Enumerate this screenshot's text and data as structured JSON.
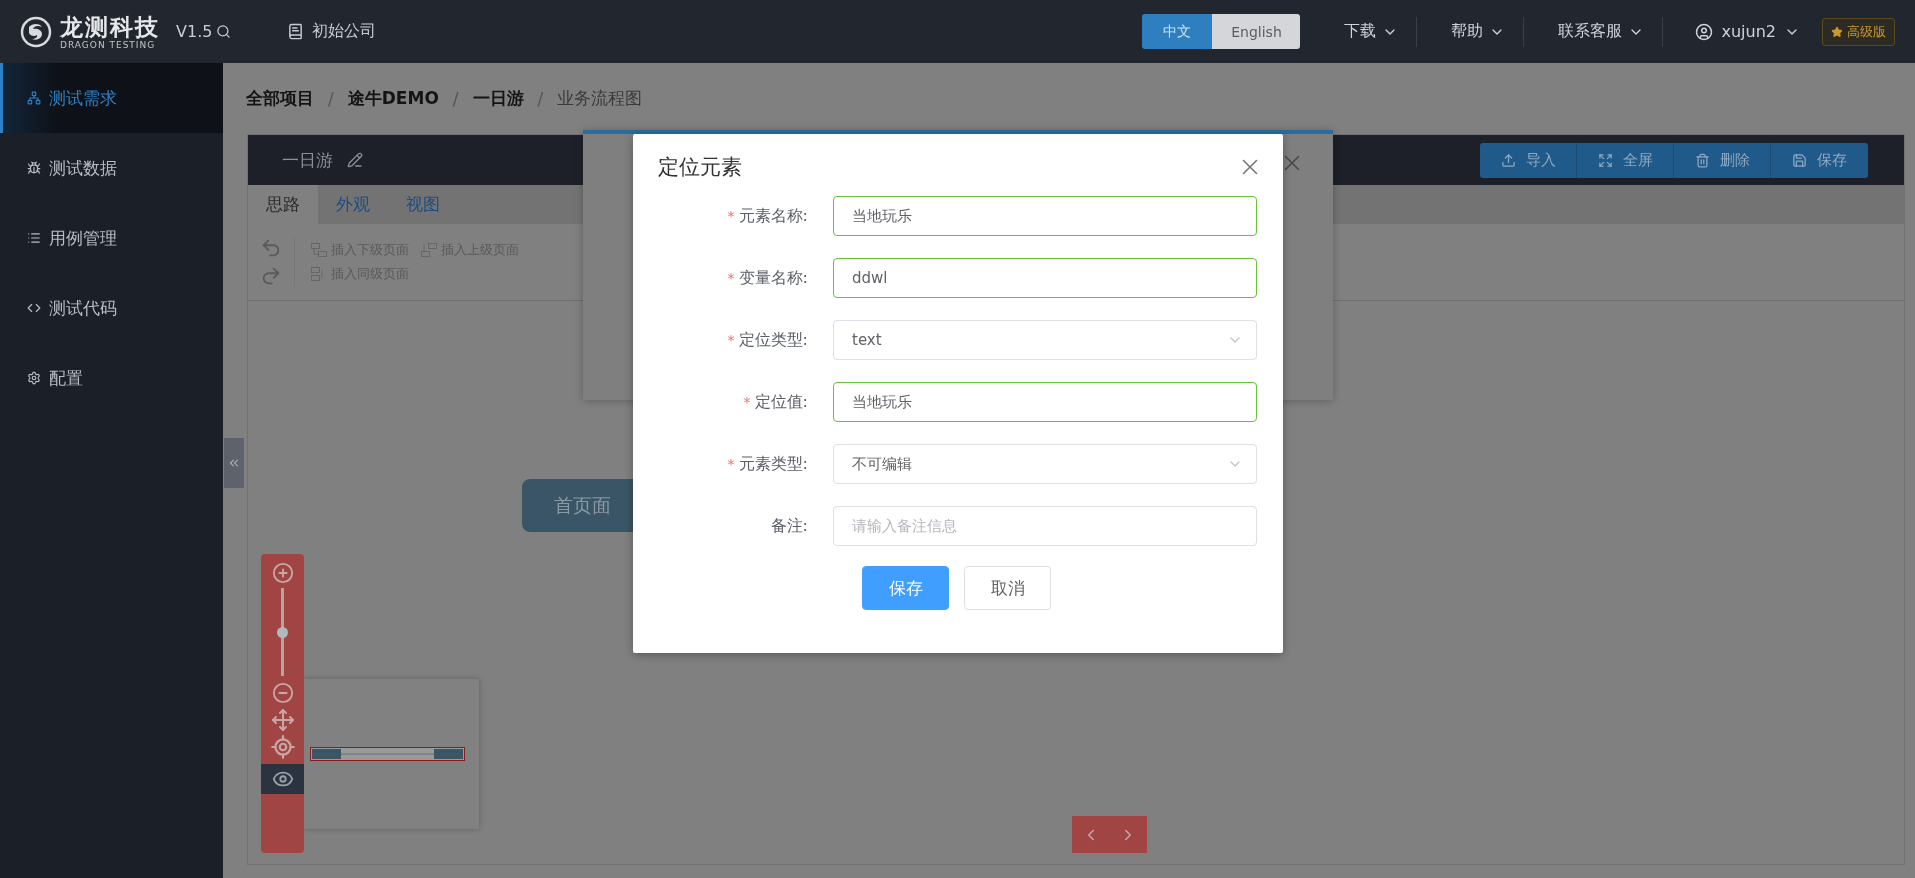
{
  "header": {
    "logo_name": "龙测科技",
    "logo_subtitle": "DRAGON TESTING",
    "version": "V1.5",
    "company": "初始公司",
    "languages": [
      {
        "label": "中文",
        "selected": true
      },
      {
        "label": "English",
        "selected": false
      }
    ],
    "menus": [
      "下载",
      "帮助",
      "联系客服"
    ],
    "user": "xujun2",
    "badge": "高级版"
  },
  "sidebar": {
    "items": [
      {
        "label": "测试需求",
        "selected": true
      },
      {
        "label": "测试数据",
        "selected": false
      },
      {
        "label": "用例管理",
        "selected": false
      },
      {
        "label": "测试代码",
        "selected": false
      },
      {
        "label": "配置",
        "selected": false
      }
    ]
  },
  "breadcrumb": [
    {
      "label": "全部项目",
      "current": false
    },
    {
      "separator": "/",
      "label": "途牛DEMO",
      "current": false
    },
    {
      "separator": "/",
      "label": "一日游",
      "current": false
    },
    {
      "separator": "/",
      "label": "业务流程图",
      "current": true
    }
  ],
  "editor": {
    "title": "一日游",
    "actions": [
      "导入",
      "全屏",
      "删除",
      "保存"
    ],
    "tabs": [
      {
        "label": "思路",
        "selected": true
      },
      {
        "label": "外观",
        "selected": false
      },
      {
        "label": "视图",
        "selected": false
      }
    ],
    "tools": [
      "插入下级页面",
      "插入上级页面",
      "插入同级页面"
    ],
    "node": "首页面",
    "zoom": {
      "level": 0.5
    }
  },
  "dialog": {
    "title": "定位元素",
    "fields": [
      {
        "label": "元素名称:",
        "required_mark": "*",
        "kind": "input",
        "value": "当地玩乐",
        "validated": true
      },
      {
        "label": "变量名称:",
        "required_mark": "*",
        "kind": "input",
        "value": "ddwl",
        "validated": true
      },
      {
        "label": "定位类型:",
        "required_mark": "*",
        "kind": "select",
        "value": "text",
        "validated": false
      },
      {
        "label": "定位值:",
        "required_mark": "*",
        "kind": "input",
        "value": "当地玩乐",
        "validated": true
      },
      {
        "label": "元素类型:",
        "required_mark": "*",
        "kind": "select",
        "value": "不可编辑",
        "validated": false
      },
      {
        "label": "备注:",
        "kind": "input",
        "placeholder": "请输入备注信息",
        "validated": false
      }
    ],
    "buttons": [
      {
        "label": "保存",
        "primary": true
      },
      {
        "label": "取消",
        "primary": false
      }
    ]
  }
}
